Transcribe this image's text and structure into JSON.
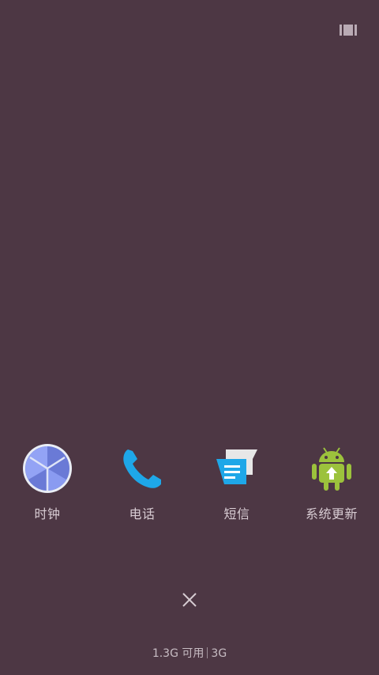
{
  "apps": [
    {
      "label": "时钟",
      "icon": "clock-icon"
    },
    {
      "label": "电话",
      "icon": "phone-icon"
    },
    {
      "label": "短信",
      "icon": "messages-icon"
    },
    {
      "label": "系统更新",
      "icon": "system-update-icon"
    }
  ],
  "top_right": {
    "icon": "layout-toggle-icon"
  },
  "close": {
    "icon": "close-icon"
  },
  "status": {
    "memory": "1.3G 可用",
    "network": "3G"
  },
  "colors": {
    "background": "#4d3744",
    "clock_face": "#8c9cf3",
    "phone": "#1ea7e8",
    "messages": "#1ea7e8",
    "android": "#9cc23c"
  }
}
